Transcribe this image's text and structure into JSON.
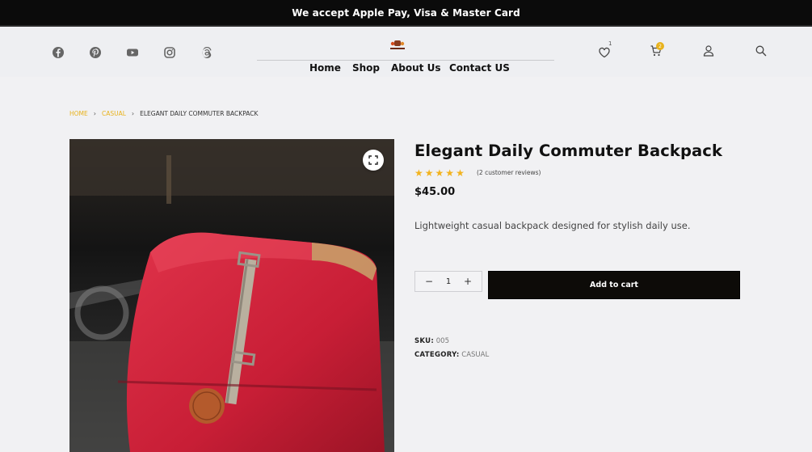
{
  "announcement": "We accept Apple Pay, Visa & Master Card",
  "social_icons": [
    "facebook-icon",
    "pinterest-icon",
    "youtube-icon",
    "instagram-icon",
    "threads-icon"
  ],
  "nav": {
    "home": "Home",
    "shop": "Shop",
    "about": "About Us",
    "contact": "Contact US"
  },
  "header_icons": {
    "wishlist_count": "1",
    "cart_count": "2"
  },
  "breadcrumb": {
    "home": "HOME",
    "category": "CASUAL",
    "current": "ELEGANT DAILY COMMUTER BACKPACK"
  },
  "product": {
    "title": "Elegant Daily Commuter Backpack",
    "rating": 5,
    "reviews": "(2 customer reviews)",
    "price": "$45.00",
    "description": "Lightweight casual backpack designed for stylish daily use.",
    "quantity": "1",
    "add_to_cart": "Add to cart",
    "sku_label": "SKU:",
    "sku": "005",
    "category_label": "CATEGORY:",
    "category": "CASUAL"
  },
  "colors": {
    "accent": "#e8b21c",
    "dark": "#0b0b0b",
    "star": "#f2b31f"
  }
}
